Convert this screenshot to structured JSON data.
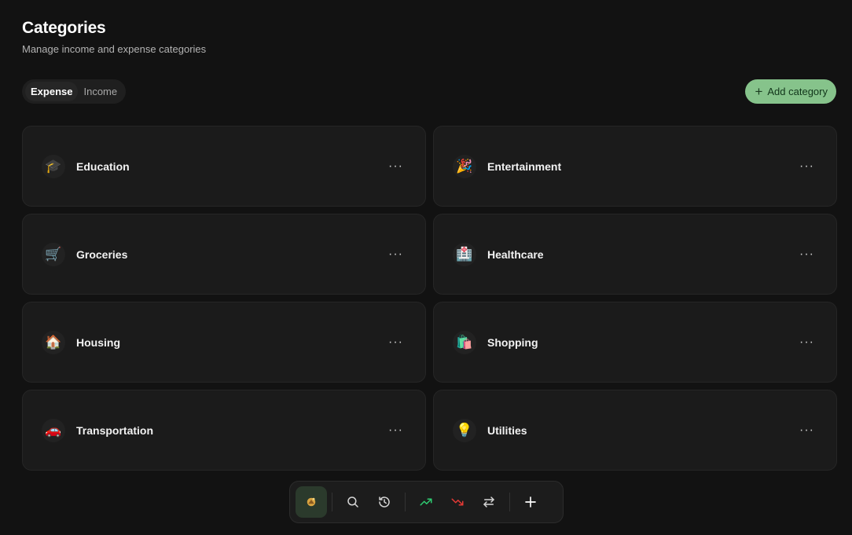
{
  "header": {
    "title": "Categories",
    "subtitle": "Manage income and expense categories"
  },
  "tabs": [
    {
      "label": "Expense",
      "active": true
    },
    {
      "label": "Income",
      "active": false
    }
  ],
  "add_button": {
    "label": "Add category",
    "icon": "plus-icon"
  },
  "categories": [
    {
      "name": "Education",
      "icon": "graduation-cap-icon",
      "glyph": "🎓"
    },
    {
      "name": "Entertainment",
      "icon": "party-popper-icon",
      "glyph": "🎉"
    },
    {
      "name": "Groceries",
      "icon": "shopping-cart-icon",
      "glyph": "🛒"
    },
    {
      "name": "Healthcare",
      "icon": "hospital-icon",
      "glyph": "🏥"
    },
    {
      "name": "Housing",
      "icon": "house-icon",
      "glyph": "🏠"
    },
    {
      "name": "Shopping",
      "icon": "shopping-bags-icon",
      "glyph": "🛍️"
    },
    {
      "name": "Transportation",
      "icon": "car-icon",
      "glyph": "🚗"
    },
    {
      "name": "Utilities",
      "icon": "light-bulb-icon",
      "glyph": "💡"
    }
  ],
  "more_glyph": "···",
  "dock": {
    "items": [
      "home-icon",
      "search-icon",
      "history-icon",
      "trending-up-icon",
      "trending-down-icon",
      "transfer-icon",
      "plus-icon"
    ],
    "active": "home-icon",
    "colors": {
      "up": "#2ecc71",
      "down": "#e53935"
    }
  }
}
